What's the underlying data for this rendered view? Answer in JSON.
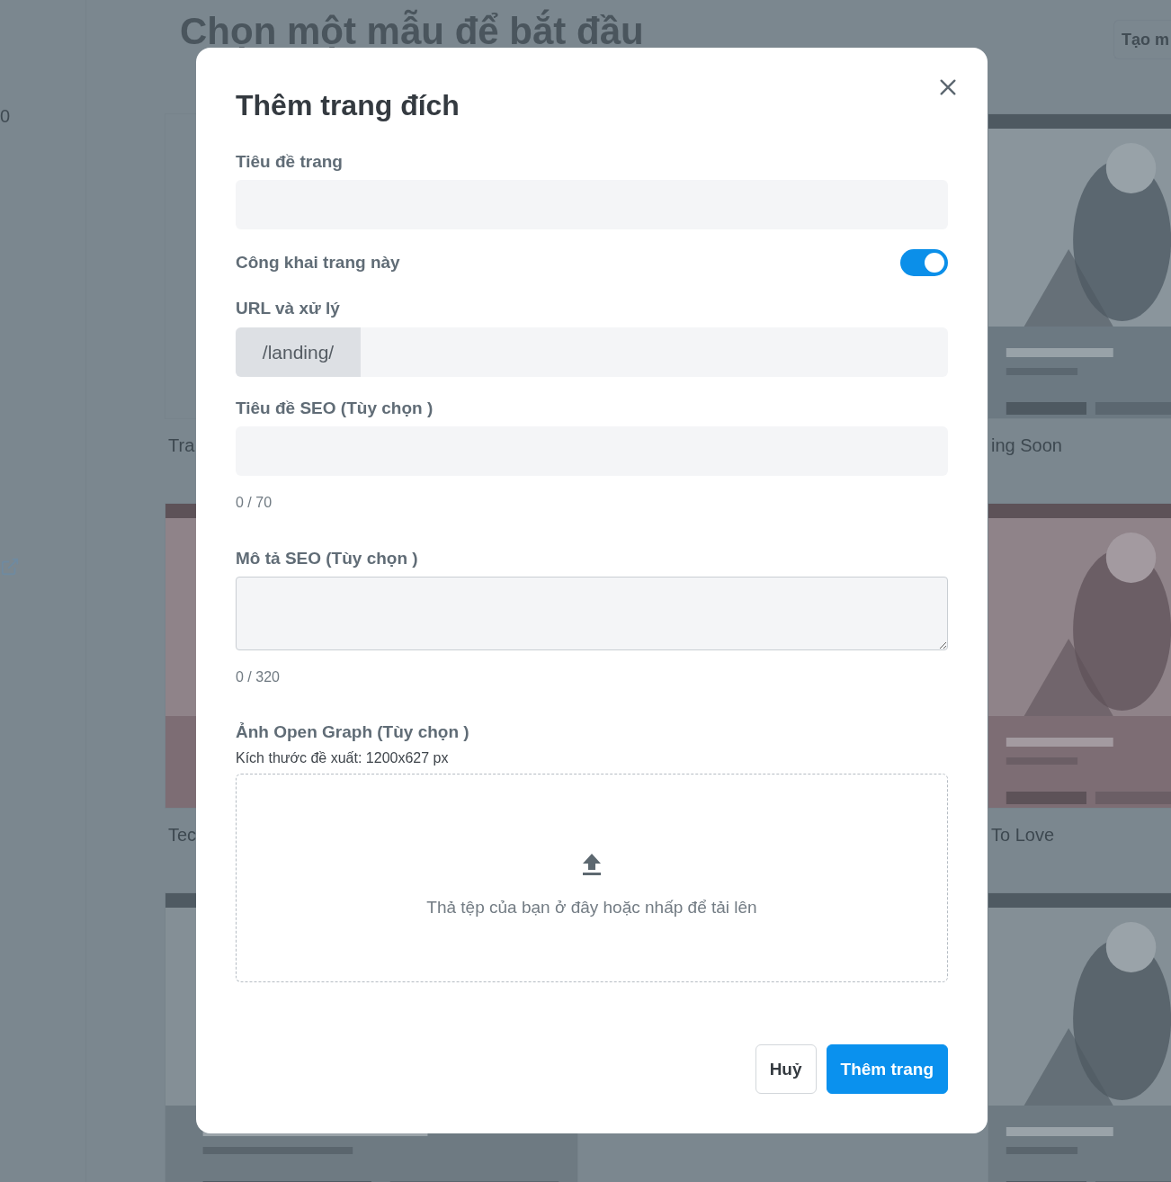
{
  "background": {
    "sidebar_text": "0",
    "heading": "Chọn một mẫu để bắt đầu",
    "create_button": "Tạo m",
    "columns": [
      {
        "cards": [
          {
            "label": "Tra"
          },
          {
            "kind": "picture",
            "label": "Tec"
          },
          {
            "kind": "picture"
          }
        ]
      },
      {
        "cards": [
          {
            "kind": "picture",
            "label": "ing Soon"
          },
          {
            "kind": "picture",
            "label": "To Love"
          },
          {
            "kind": "picture"
          }
        ]
      }
    ]
  },
  "dialog": {
    "title": "Thêm trang đích",
    "fields": [
      {
        "kind": "text",
        "label": "Tiêu đề trang"
      },
      {
        "kind": "toggle",
        "label": "Công khai trang này",
        "on": true
      },
      {
        "kind": "prefixed",
        "label": "URL và xử lý",
        "prefix": "/landing/"
      },
      {
        "kind": "text",
        "label": "Tiêu đề SEO (Tùy chọn )",
        "counter": "0 / 70"
      },
      {
        "kind": "textarea",
        "label": "Mô tả SEO (Tùy chọn )",
        "counter": "0 / 320"
      },
      {
        "kind": "upload",
        "label": "Ảnh Open Graph (Tùy chọn )",
        "hint": "Kích thước đề xuất: 1200x627 px",
        "dropzone_text": "Thả tệp của bạn ở đây hoặc nhấp để tải lên"
      }
    ],
    "buttons": [
      {
        "kind": "secondary",
        "label": "Huỷ"
      },
      {
        "kind": "primary",
        "label": "Thêm trang"
      }
    ]
  }
}
